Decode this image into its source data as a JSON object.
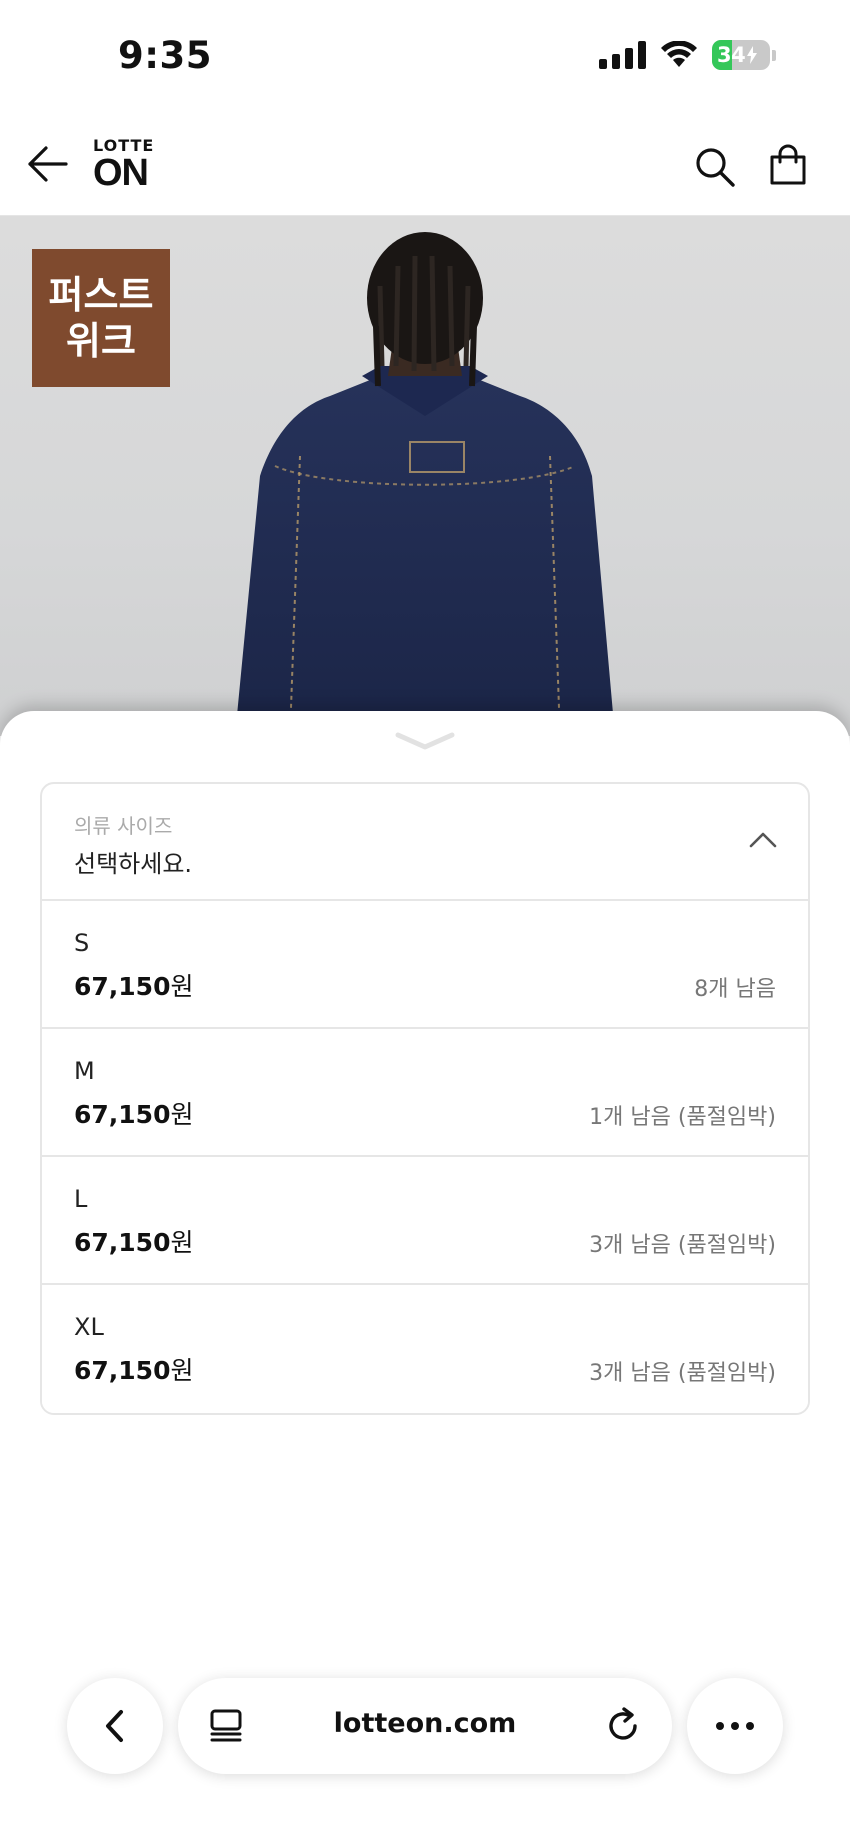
{
  "status_bar": {
    "time": "9:35",
    "battery": "34"
  },
  "header": {
    "logo_top": "LOTTE",
    "logo_bottom": "ON",
    "icons": [
      "arrow-left-icon",
      "search-icon",
      "shopping-bag-icon"
    ]
  },
  "product": {
    "badge_line1": "퍼스트",
    "badge_line2": "위크",
    "badge_color": "#7f4a2e"
  },
  "size_selector": {
    "label": "의류 사이즈",
    "value": "선택하세요.",
    "options": [
      {
        "size": "S",
        "price": "67,150",
        "currency": "원",
        "stock": "8개 남음"
      },
      {
        "size": "M",
        "price": "67,150",
        "currency": "원",
        "stock": "1개 남음 (품절임박)"
      },
      {
        "size": "L",
        "price": "67,150",
        "currency": "원",
        "stock": "3개 남음 (품절임박)"
      },
      {
        "size": "XL",
        "price": "67,150",
        "currency": "원",
        "stock": "3개 남음 (품절임박)"
      }
    ]
  },
  "browser": {
    "url": "lotteon.com",
    "icons": [
      "chevron-left-icon",
      "tabs-icon",
      "reload-icon",
      "more-icon"
    ]
  },
  "colors": {
    "badge": "#7f4a2e",
    "battery_green": "#34c759",
    "jacket_navy": "#1f2a4d"
  }
}
